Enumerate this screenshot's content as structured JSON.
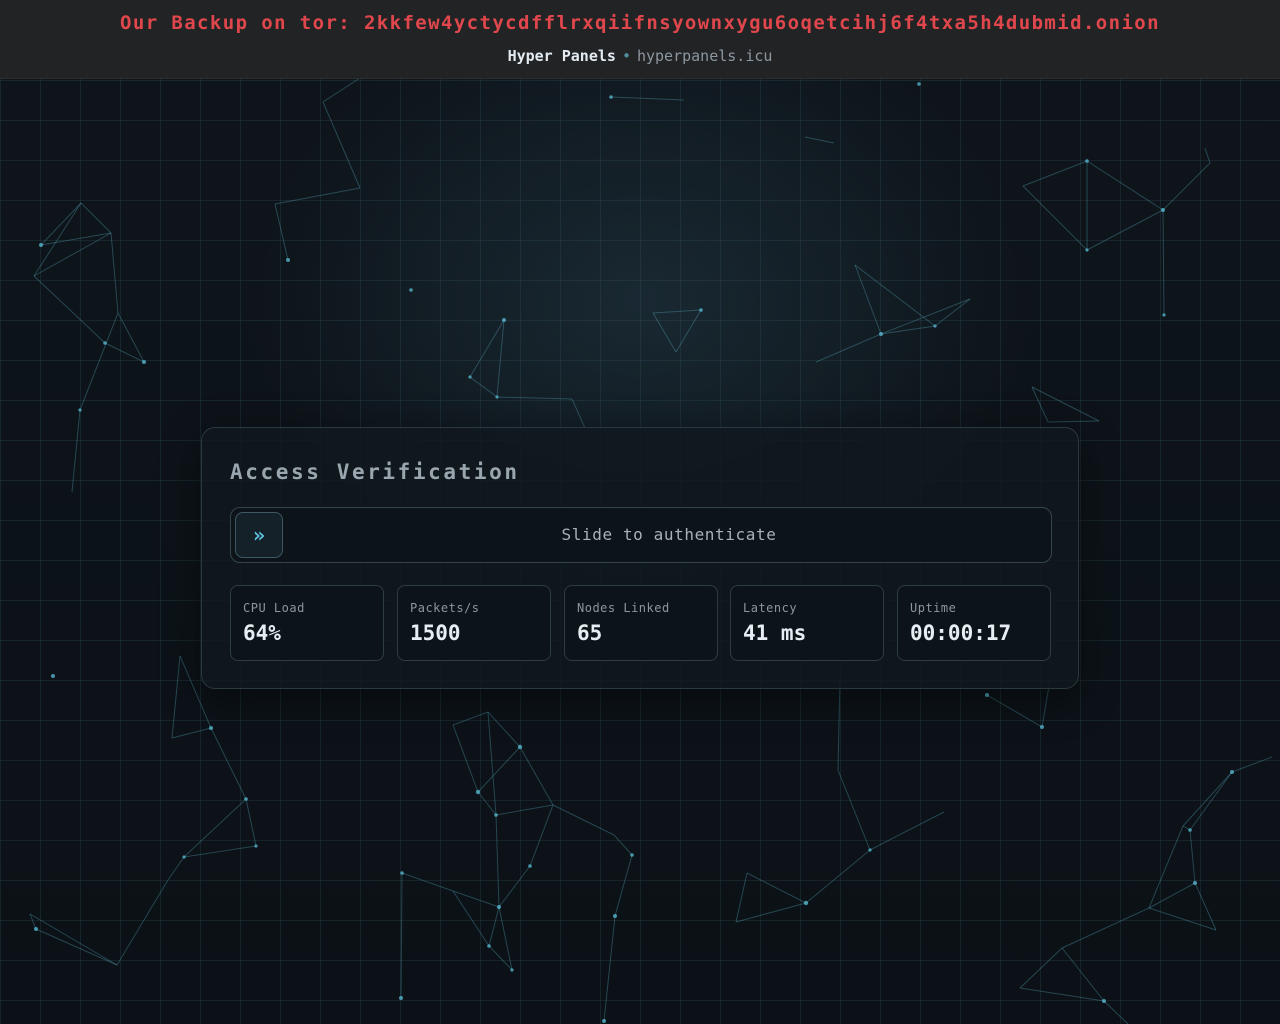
{
  "banner": {
    "text": "Our Backup on tor: 2kkfew4yctycdfflrxqiifnsyownxygu6oqetcihj6f4txa5h4dubmid.onion",
    "color": "#e0474c"
  },
  "site": {
    "name": "Hyper Panels",
    "separator": "•",
    "domain": "hyperpanels.icu"
  },
  "verification": {
    "title": "Access Verification",
    "slider": {
      "handle_icon": "double-chevron-right-icon",
      "handle_glyph": "»",
      "label": "Slide to authenticate"
    },
    "stats": [
      {
        "label": "CPU Load",
        "value": "64%"
      },
      {
        "label": "Packets/s",
        "value": "1500"
      },
      {
        "label": "Nodes Linked",
        "value": "65"
      },
      {
        "label": "Latency",
        "value": "41 ms"
      },
      {
        "label": "Uptime",
        "value": "00:00:17"
      }
    ]
  },
  "theme": {
    "accent": "#5ec3df",
    "background": "#0c1217",
    "topbar": "#222325"
  }
}
